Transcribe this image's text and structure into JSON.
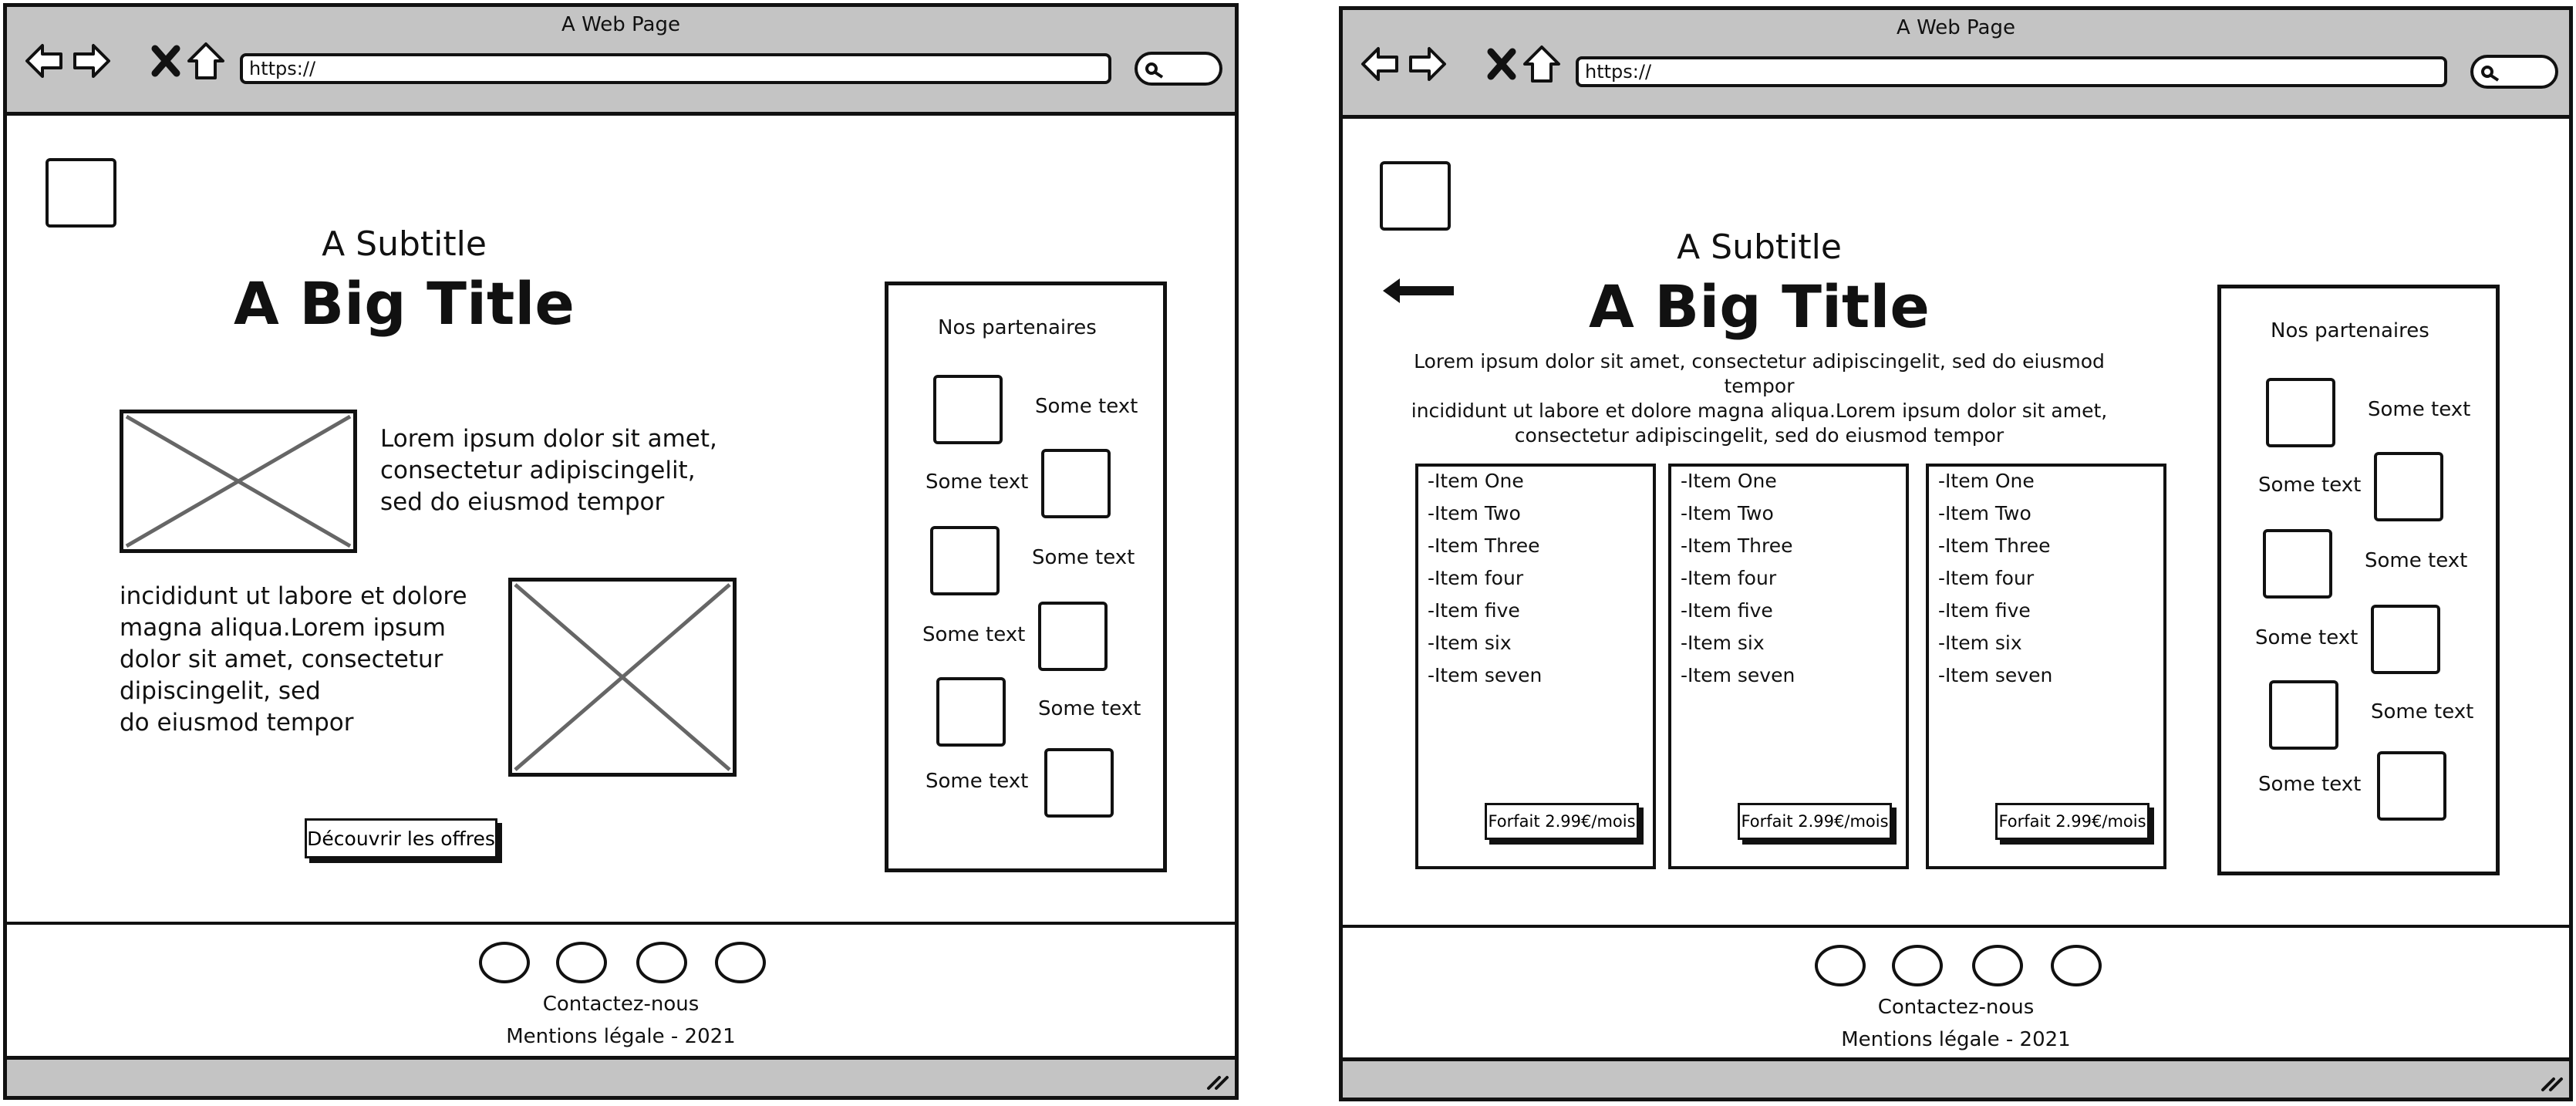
{
  "browser": {
    "title": "A Web Page",
    "url": "https://",
    "icons": [
      "back-arrow-icon",
      "forward-arrow-icon",
      "close-x-icon",
      "home-icon",
      "search-icon",
      "resize-grip-icon"
    ]
  },
  "hero": {
    "subtitle": "A Subtitle",
    "title": "A Big Title"
  },
  "left_page": {
    "text_1": [
      "Lorem ipsum dolor sit amet,",
      "consectetur adipiscingelit,",
      "sed do eiusmod tempor"
    ],
    "text_2": [
      "incididunt ut labore et dolore",
      "magna aliqua.Lorem ipsum",
      "dolor sit amet, consectetur",
      "dipiscingelit, sed",
      "do eiusmod tempor"
    ],
    "cta_label": "Découvrir les offres"
  },
  "right_page": {
    "intro": [
      "Lorem ipsum dolor sit amet, consectetur adipiscingelit, sed do eiusmod tempor",
      "incididunt ut labore et dolore magna aliqua.Lorem ipsum dolor sit amet,",
      "consectetur adipiscingelit, sed do eiusmod tempor"
    ],
    "plans": [
      {
        "items": [
          "-Item One",
          "-Item Two",
          "-Item Three",
          "-Item four",
          "-Item five",
          "-Item six",
          "-Item seven"
        ],
        "button": "Forfait 2.99€/mois"
      },
      {
        "items": [
          "-Item One",
          "-Item Two",
          "-Item Three",
          "-Item four",
          "-Item five",
          "-Item six",
          "-Item seven"
        ],
        "button": "Forfait 2.99€/mois"
      },
      {
        "items": [
          "-Item One",
          "-Item Two",
          "-Item Three",
          "-Item four",
          "-Item five",
          "-Item six",
          "-Item seven"
        ],
        "button": "Forfait 2.99€/mois"
      }
    ]
  },
  "partners": {
    "title": "Nos partenaires",
    "labels": [
      "Some text",
      "Some text",
      "Some text",
      "Some text",
      "Some text",
      "Some text"
    ]
  },
  "footer": {
    "contact": "Contactez-nous",
    "legal": "Mentions légale - 2021"
  }
}
